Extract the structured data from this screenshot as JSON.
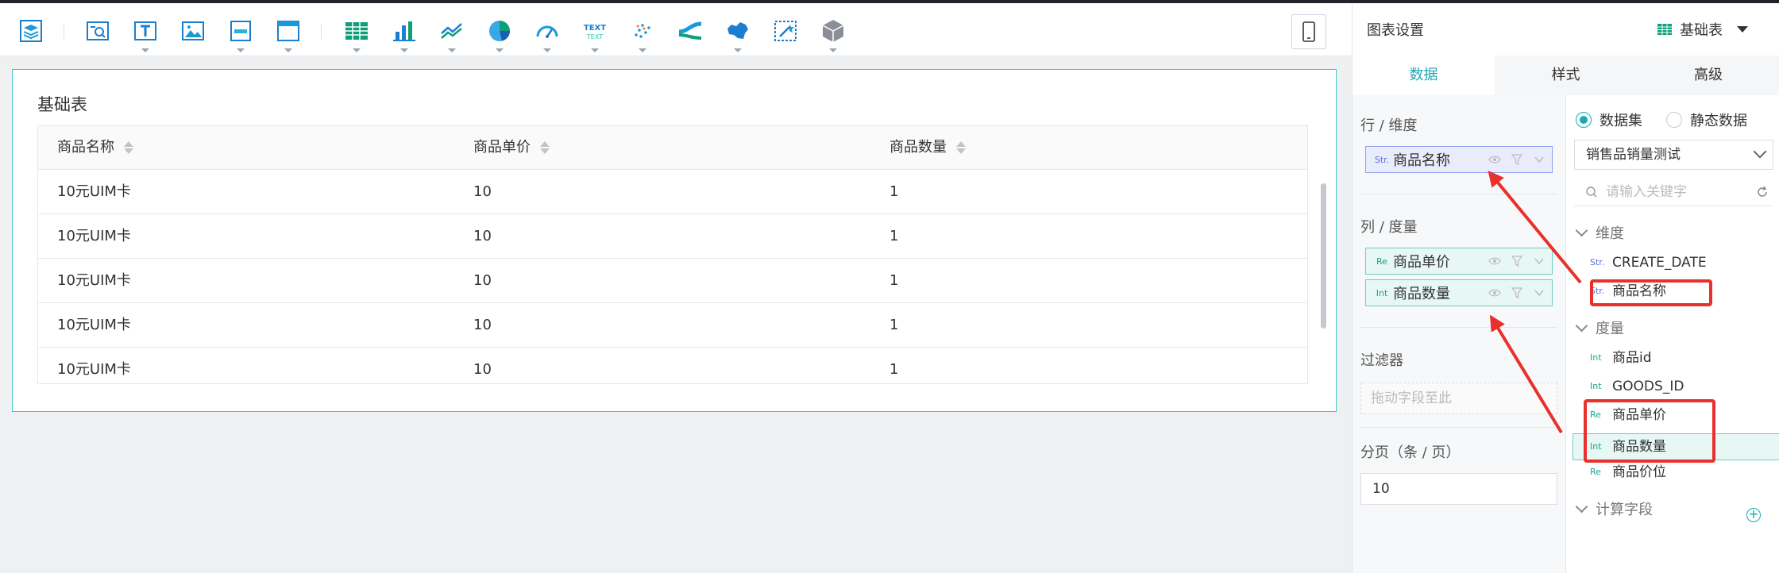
{
  "toolbar": {
    "icons": [
      "layers-icon",
      "search-panel-icon",
      "text-box-icon",
      "image-icon",
      "layout-icon",
      "window-icon",
      "table-icon",
      "bar-chart-icon",
      "line-chart-icon",
      "pie-chart-icon",
      "gauge-icon",
      "text-text-icon",
      "scatter-icon",
      "sankey-icon",
      "china-map-icon",
      "magic-select-icon",
      "cube-icon"
    ],
    "text_icon_label": "TEXT"
  },
  "widget": {
    "title": "基础表",
    "columns": [
      "商品名称",
      "商品单价",
      "商品数量"
    ],
    "rows": [
      [
        "10元UIM卡",
        "10",
        "1"
      ],
      [
        "10元UIM卡",
        "10",
        "1"
      ],
      [
        "10元UIM卡",
        "10",
        "1"
      ],
      [
        "10元UIM卡",
        "10",
        "1"
      ],
      [
        "10元UIM卡",
        "10",
        "1"
      ]
    ]
  },
  "panel": {
    "title": "图表设置",
    "chart_type": "基础表",
    "tabs": [
      "数据",
      "样式",
      "高级"
    ],
    "active_tab": "数据",
    "rows_label": "行 / 维度",
    "rows_fields": [
      {
        "type": "Str.",
        "name": "商品名称"
      }
    ],
    "cols_label": "列 / 度量",
    "cols_fields": [
      {
        "type": "Re",
        "name": "商品单价"
      },
      {
        "type": "Int",
        "name": "商品数量"
      }
    ],
    "filter_label": "过滤器",
    "filter_placeholder": "拖动字段至此",
    "page_label": "分页（条 / 页）",
    "page_value": "10",
    "source_dataset": "数据集",
    "source_static": "静态数据",
    "dataset_selected": "销售品销量测试",
    "search_placeholder": "请输入关键字",
    "dimension_group": "维度",
    "dimensions": [
      {
        "type": "Str.",
        "name": "CREATE_DATE"
      },
      {
        "type": "Str.",
        "name": "商品名称"
      }
    ],
    "measure_group": "度量",
    "measures": [
      {
        "type": "Int",
        "name": "商品id"
      },
      {
        "type": "Int",
        "name": "GOODS_ID"
      },
      {
        "type": "Re",
        "name": "商品单价"
      },
      {
        "type": "Int",
        "name": "商品数量"
      },
      {
        "type": "Re",
        "name": "商品价位"
      }
    ],
    "calc_group": "计算字段"
  },
  "colors": {
    "accent": "#1ba9b3",
    "annotation": "#e8302d",
    "selected_row": "#e6f7f4"
  }
}
